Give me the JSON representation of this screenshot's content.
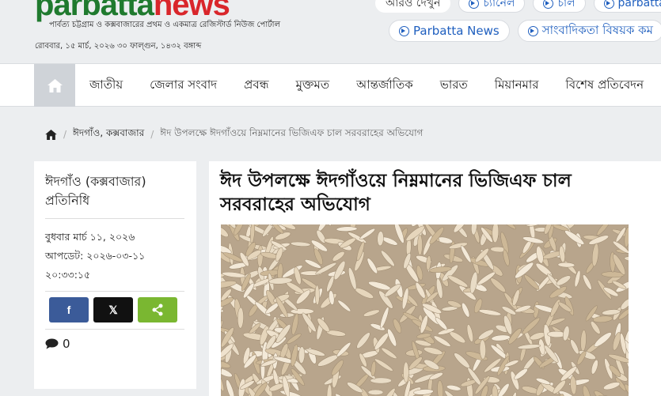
{
  "header": {
    "logo_part1": "parbatta",
    "logo_part2": "news",
    "tagline": "পার্বত্য চট্টগ্রাম ও কক্সবাজারের প্রথম ও একমাত্র রেজিস্টার্ড নিউজ পোর্টাল",
    "dateline": "রোববার, ১৫ মার্চ, ২০২৬ ৩০ ফাল্গুন, ১৪৩২ বঙ্গাব্দ",
    "top_links": [
      "আরও দেখুন",
      "চ্যানেল",
      "চাল",
      "parbatta"
    ],
    "second_links": [
      "Parbatta News",
      "সাংবাদিকতা বিষয়ক কম"
    ]
  },
  "nav": {
    "items": [
      "জাতীয়",
      "জেলার সংবাদ",
      "প্রবন্ধ",
      "মুক্তমত",
      "আন্তর্জাতিক",
      "ভারত",
      "মিয়ানমার",
      "বিশেষ প্রতিবেদন"
    ]
  },
  "breadcrumb": {
    "section": "ঈদগাঁও, কক্সবাজার",
    "current": "ঈদ উপলক্ষে ঈদগাঁওয়ে নিম্নমানের ভিজিএফ চাল সরবরাহের অভিযোগ"
  },
  "sidebar": {
    "author": "ঈদগাঁও (কক্সবাজার) প্রতিনিধি",
    "published": "বুধবার মার্চ ১১, ২০২৬",
    "updated": "আপডেট: ২০২৬-০৩-১১ ২০:৩৩:১৫",
    "share": {
      "facebook": "f",
      "x": "𝕏",
      "sharethis": "<"
    },
    "comment_count": "0"
  },
  "article": {
    "headline": "ঈদ উপলক্ষে ঈদগাঁওয়ে নিম্নমানের ভিজিএফ চাল সরবরাহের অভিযোগ"
  },
  "colors": {
    "logo_green": "#1f7a2e",
    "logo_red": "#d9262b",
    "link_blue": "#1f5fbf",
    "facebook": "#3b5b99",
    "x": "#111111",
    "sharethis": "#7ab731"
  }
}
